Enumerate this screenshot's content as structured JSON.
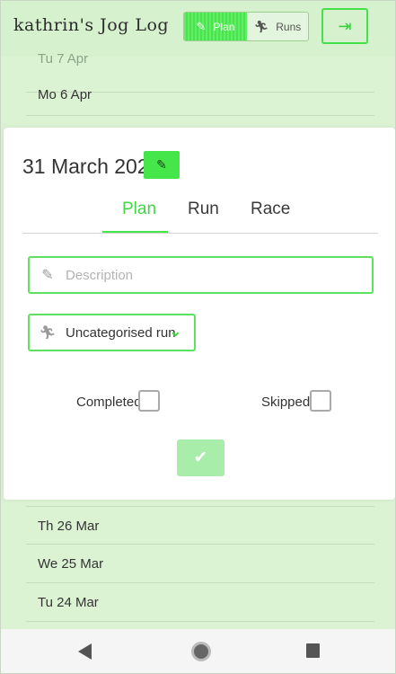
{
  "header": {
    "app_title": "kathrin's Jog Log",
    "toggle": {
      "plan_label": "Plan",
      "runs_label": "Runs"
    },
    "logout_icon": "sign-out-icon"
  },
  "list_top": [
    {
      "label": "Tu 7 Apr"
    },
    {
      "label": "Mo 6 Apr"
    }
  ],
  "modal": {
    "date": "31 March 2020",
    "tabs": [
      {
        "label": "Plan",
        "active": true
      },
      {
        "label": "Run",
        "active": false
      },
      {
        "label": "Race",
        "active": false
      }
    ],
    "description_placeholder": "Description",
    "run_type": "Uncategorised run",
    "completed_label": "Completed",
    "skipped_label": "Skipped"
  },
  "list_bottom": [
    {
      "label": "Th 26 Mar"
    },
    {
      "label": "We 25 Mar"
    },
    {
      "label": "Tu 24 Mar"
    }
  ],
  "colors": {
    "accent": "#45e649",
    "background": "#dbf3d3"
  }
}
